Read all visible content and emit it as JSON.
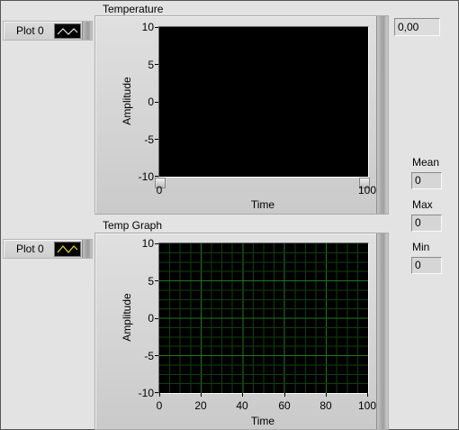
{
  "top_graph": {
    "title": "Temperature",
    "legend_label": "Plot 0",
    "y_ticks": [
      "10",
      "5",
      "0",
      "-5",
      "-10"
    ],
    "x_ticks": [
      "0",
      "100"
    ],
    "y_label": "Amplitude",
    "x_label": "Time",
    "background": "#000000",
    "grid": false
  },
  "bottom_graph": {
    "title": "Temp Graph",
    "legend_label": "Plot 0",
    "y_ticks": [
      "10",
      "5",
      "0",
      "-5",
      "-10"
    ],
    "x_ticks": [
      "0",
      "20",
      "40",
      "60",
      "80",
      "100"
    ],
    "y_label": "Amplitude",
    "x_label": "Time",
    "background": "#000000",
    "grid": true,
    "grid_color": "#1e7a1e"
  },
  "temperature_value": "0,00",
  "stats": {
    "mean_label": "Mean",
    "mean_value": "0",
    "max_label": "Max",
    "max_value": "0",
    "min_label": "Min",
    "min_value": "0"
  }
}
